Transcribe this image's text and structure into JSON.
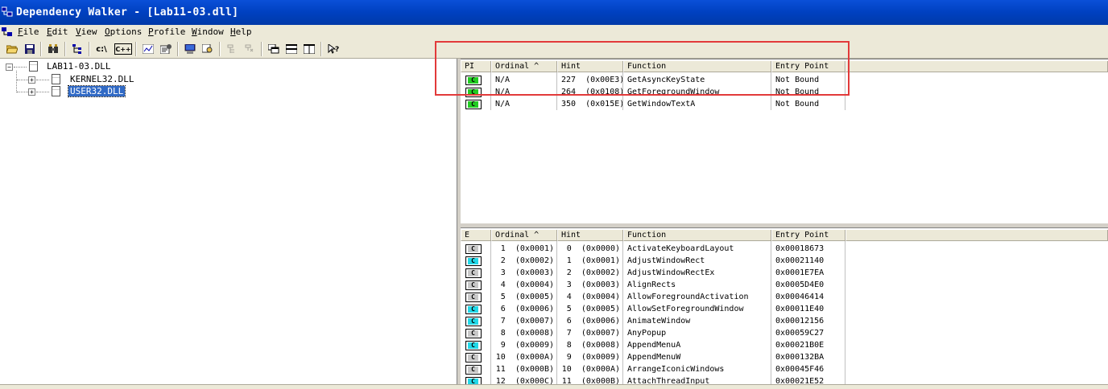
{
  "window": {
    "title": "Dependency Walker - [Lab11-03.dll]"
  },
  "menu": [
    "File",
    "Edit",
    "View",
    "Options",
    "Profile",
    "Window",
    "Help"
  ],
  "toolbar": {
    "cpath_label": "c:\\",
    "cpp_label": "C++"
  },
  "tree": {
    "root": "LAB11-03.DLL",
    "children": [
      "KERNEL32.DLL",
      "USER32.DLL"
    ],
    "selected": "USER32.DLL"
  },
  "imports": {
    "columns": [
      "PI",
      "Ordinal ^",
      "Hint",
      "Function",
      "Entry Point"
    ],
    "rows": [
      {
        "badge": "C",
        "ordinal": "N/A",
        "hint": "227  (0x00E3)",
        "function": "GetAsyncKeyState",
        "entry": "Not Bound"
      },
      {
        "badge": "C",
        "ordinal": "N/A",
        "hint": "264  (0x0108)",
        "function": "GetForegroundWindow",
        "entry": "Not Bound"
      },
      {
        "badge": "C",
        "ordinal": "N/A",
        "hint": "350  (0x015E)",
        "function": "GetWindowTextA",
        "entry": "Not Bound"
      }
    ]
  },
  "exports": {
    "columns": [
      "E",
      "Ordinal ^",
      "Hint",
      "Function",
      "Entry Point"
    ],
    "rows": [
      {
        "badge": "C",
        "ordinal": "1  (0x0001)",
        "hint": "0  (0x0000)",
        "function": "ActivateKeyboardLayout",
        "entry": "0x00018673"
      },
      {
        "badge": "C",
        "ordinal": "2  (0x0002)",
        "hint": "1  (0x0001)",
        "function": "AdjustWindowRect",
        "entry": "0x00021140"
      },
      {
        "badge": "C",
        "ordinal": "3  (0x0003)",
        "hint": "2  (0x0002)",
        "function": "AdjustWindowRectEx",
        "entry": "0x0001E7EA"
      },
      {
        "badge": "C",
        "ordinal": "4  (0x0004)",
        "hint": "3  (0x0003)",
        "function": "AlignRects",
        "entry": "0x0005D4E0"
      },
      {
        "badge": "C",
        "ordinal": "5  (0x0005)",
        "hint": "4  (0x0004)",
        "function": "AllowForegroundActivation",
        "entry": "0x00046414"
      },
      {
        "badge": "C",
        "ordinal": "6  (0x0006)",
        "hint": "5  (0x0005)",
        "function": "AllowSetForegroundWindow",
        "entry": "0x00011E40"
      },
      {
        "badge": "C",
        "ordinal": "7  (0x0007)",
        "hint": "6  (0x0006)",
        "function": "AnimateWindow",
        "entry": "0x00012156"
      },
      {
        "badge": "C",
        "ordinal": "8  (0x0008)",
        "hint": "7  (0x0007)",
        "function": "AnyPopup",
        "entry": "0x00059C27"
      },
      {
        "badge": "C",
        "ordinal": "9  (0x0009)",
        "hint": "8  (0x0008)",
        "function": "AppendMenuA",
        "entry": "0x00021B0E"
      },
      {
        "badge": "C",
        "ordinal": "10  (0x000A)",
        "hint": "9  (0x0009)",
        "function": "AppendMenuW",
        "entry": "0x000132BA"
      },
      {
        "badge": "C",
        "ordinal": "11  (0x000B)",
        "hint": "10  (0x000A)",
        "function": "ArrangeIconicWindows",
        "entry": "0x00045F46"
      },
      {
        "badge": "C",
        "ordinal": "12  (0x000C)",
        "hint": "11  (0x000B)",
        "function": "AttachThreadInput",
        "entry": "0x00021E52"
      }
    ]
  },
  "colors": {
    "import_badge": "#22cc22",
    "export_badge_cyan": "#22d8e8",
    "export_badge_gray": "#c8c8c8",
    "highlight": "#e23a3a",
    "selection": "#316ac5"
  }
}
